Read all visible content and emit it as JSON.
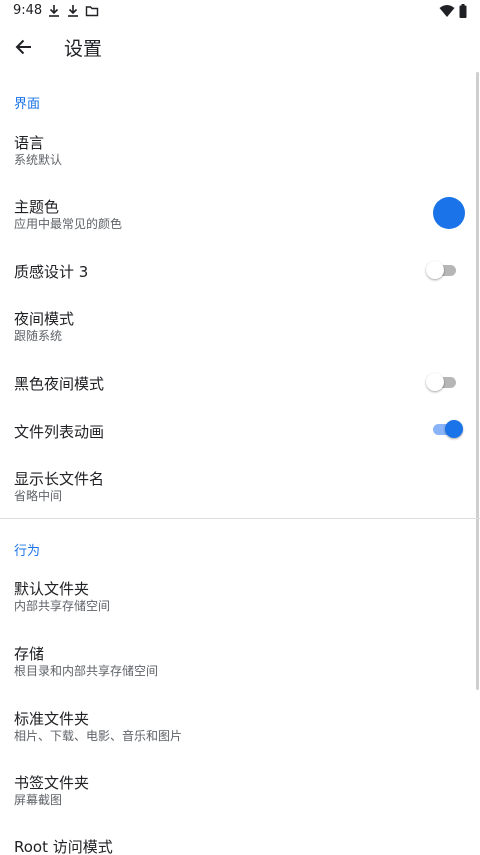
{
  "status_bar": {
    "time": "9:48",
    "icons": [
      "download-icon",
      "download-icon",
      "folder-icon",
      "wifi-icon",
      "battery-icon"
    ]
  },
  "app_bar": {
    "title": "设置",
    "back_icon": "arrow-back-icon"
  },
  "sections": {
    "interface": {
      "header": "界面",
      "items": {
        "language": {
          "title": "语言",
          "summary": "系统默认"
        },
        "theme_color": {
          "title": "主题色",
          "summary": "应用中最常见的颜色",
          "color": "#1a73e8"
        },
        "material3": {
          "title": "质感设计 3",
          "enabled": false
        },
        "night_mode": {
          "title": "夜间模式",
          "summary": "跟随系统"
        },
        "black_night": {
          "title": "黑色夜间模式",
          "enabled": false
        },
        "list_animation": {
          "title": "文件列表动画",
          "enabled": true
        },
        "long_filename": {
          "title": "显示长文件名",
          "summary": "省略中间"
        }
      }
    },
    "behavior": {
      "header": "行为",
      "items": {
        "default_folder": {
          "title": "默认文件夹",
          "summary": "内部共享存储空间"
        },
        "storage": {
          "title": "存储",
          "summary": "根目录和内部共享存储空间"
        },
        "standard_folders": {
          "title": "标准文件夹",
          "summary": "相片、下载、电影、音乐和图片"
        },
        "bookmark_folders": {
          "title": "书签文件夹",
          "summary": "屏幕截图"
        },
        "root_access": {
          "title": "Root 访问模式"
        }
      }
    }
  },
  "colors": {
    "accent": "#1a73e8",
    "switch_off_track": "#b6b6b6",
    "switch_on_track": "#8ab4f8"
  }
}
